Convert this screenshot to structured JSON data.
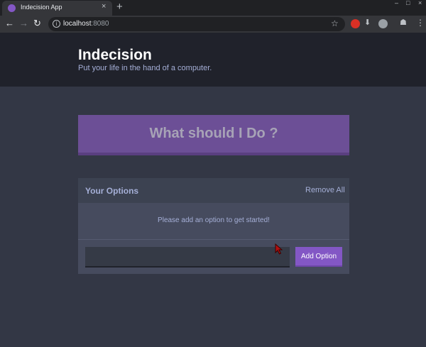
{
  "browser": {
    "tab_title": "Indecision App",
    "tab_close": "×",
    "new_tab": "+",
    "url_host": "localhost",
    "url_port": ":8080",
    "window_controls": [
      "–",
      "□",
      "×"
    ]
  },
  "app": {
    "title": "Indecision",
    "subtitle": "Put your life in the hand of a computer."
  },
  "action": {
    "label": "What should I Do ?"
  },
  "options": {
    "title": "Your Options",
    "remove_all_label": "Remove All",
    "empty_message": "Please add an option to get started!",
    "input_value": "",
    "add_label": "Add Option"
  },
  "colors": {
    "header_bg": "#20222b",
    "page_bg": "#333745",
    "accent_purple": "#8357c5",
    "big_button_bg": "#6c4f96",
    "text_light_blue": "#a5afd7"
  }
}
